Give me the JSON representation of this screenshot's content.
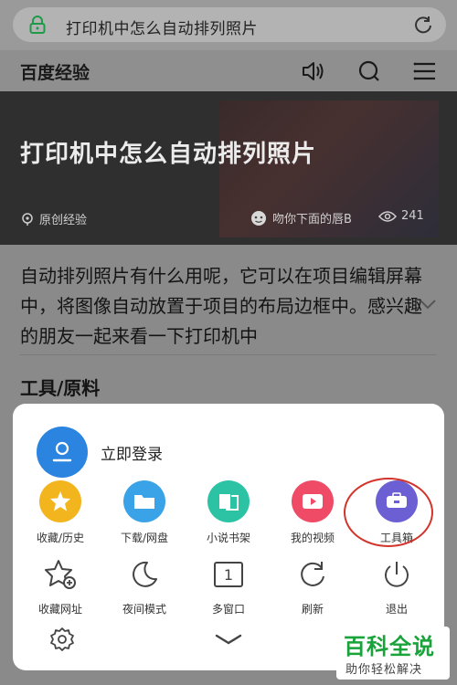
{
  "url_bar": {
    "text": "打印机中怎么自动排列照片",
    "lock_icon": "lock-icon",
    "reload_icon": "reload-icon"
  },
  "header": {
    "brand": "百度经验",
    "icons": [
      "speaker-icon",
      "search-icon",
      "menu-icon"
    ]
  },
  "hero": {
    "title": "打印机中怎么自动排列照片",
    "tag": "原创经验",
    "author": "吻你下面的唇B",
    "views": "241"
  },
  "article": {
    "intro": "自动排列照片有什么用呢，它可以在项目编辑屏幕中，将图像自动放置于项目的布局边框中。感兴趣的朋友一起来看一下打印机中",
    "section_title": "工具/原料"
  },
  "menu": {
    "login_label": "立即登录",
    "row1": [
      {
        "label": "收藏/历史",
        "icon": "star-icon",
        "color": "#f3b51d"
      },
      {
        "label": "下载/网盘",
        "icon": "folder-icon",
        "color": "#3aa3e8"
      },
      {
        "label": "小说书架",
        "icon": "book-icon",
        "color": "#2bc3a4"
      },
      {
        "label": "我的视频",
        "icon": "play-icon",
        "color": "#ef4b67"
      },
      {
        "label": "工具箱",
        "icon": "toolbox-icon",
        "color": "#6b5fd3"
      }
    ],
    "row2": [
      {
        "label": "收藏网址",
        "icon": "add-bookmark-icon"
      },
      {
        "label": "夜间模式",
        "icon": "moon-icon"
      },
      {
        "label": "多窗口",
        "icon": "window-count-icon",
        "count": "1"
      },
      {
        "label": "刷新",
        "icon": "refresh-icon"
      },
      {
        "label": "退出",
        "icon": "power-icon"
      }
    ]
  },
  "watermark": {
    "main": "百科全说",
    "sub": "助你轻松解决"
  },
  "colors": {
    "highlight": "#d2342b",
    "brand_green": "#1aa33a"
  }
}
